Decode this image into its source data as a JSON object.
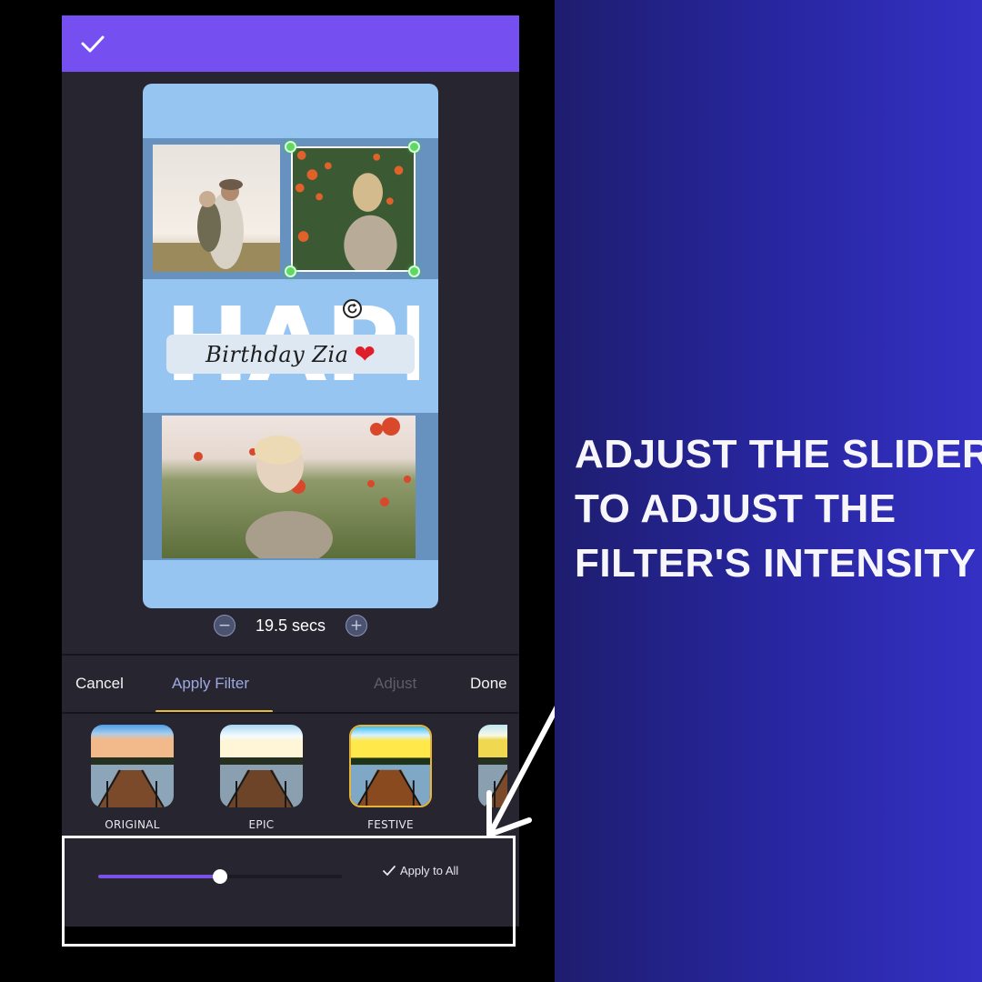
{
  "topbar": {
    "confirm_icon": "checkmark-icon",
    "color": "#754ff0"
  },
  "canvas": {
    "background_color": "#95c5f0",
    "headline": "HAPPY",
    "label_text": "Birthday Zia",
    "label_emoji": "❤",
    "photos": [
      {
        "name": "mother-holding-child-in-field"
      },
      {
        "name": "girl-in-orange-flowers",
        "selected": true
      },
      {
        "name": "girl-in-poppy-field"
      }
    ],
    "rotate_icon": "rotate-icon"
  },
  "duration": {
    "value": "19.5 secs",
    "decrease_icon": "minus-icon",
    "increase_icon": "plus-icon",
    "minus_glyph": "−",
    "plus_glyph": "+"
  },
  "tabs": {
    "cancel": "Cancel",
    "apply_filter": "Apply  Filter",
    "adjust": "Adjust",
    "done": "Done",
    "active": "apply_filter",
    "accent_color": "#e7b93c"
  },
  "filters": {
    "items": [
      {
        "label": "ORIGINAL",
        "selected": false
      },
      {
        "label": "EPIC",
        "selected": false
      },
      {
        "label": "FESTIVE",
        "selected": true
      },
      {
        "label": "",
        "selected": false
      }
    ]
  },
  "intensity": {
    "slider_value": 0.5,
    "fill_color": "#7a52e8",
    "apply_to_all_label": "Apply to All",
    "apply_to_all_checked": true
  },
  "promo": {
    "lines": [
      "ADJUST THE SLIDER",
      "TO ADJUST THE",
      "FILTER'S INTENSITY"
    ]
  }
}
